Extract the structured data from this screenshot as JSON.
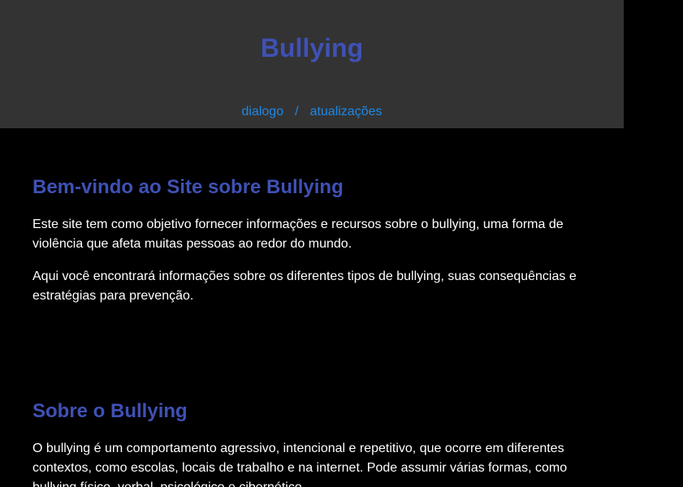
{
  "header": {
    "title": "Bullying",
    "nav": {
      "dialogo": "dialogo",
      "separator": "/",
      "atualizacoes": "atualizações"
    }
  },
  "welcome": {
    "heading": "Bem-vindo ao Site sobre Bullying",
    "paragraphs": [
      "Este site tem como objetivo fornecer informações e recursos sobre o bullying, uma forma de violência que afeta muitas pessoas ao redor do mundo.",
      "Aqui você encontrará informações sobre os diferentes tipos de bullying, suas consequências e estratégias para prevenção."
    ]
  },
  "about": {
    "heading": "Sobre o Bullying",
    "paragraphs": [
      "O bullying é um comportamento agressivo, intencional e repetitivo, que ocorre em diferentes contextos, como escolas, locais de trabalho e na internet. Pode assumir várias formas, como bullying físico, verbal, psicológico e cibernético."
    ]
  },
  "colors": {
    "header_bg": "#333333",
    "page_bg": "#000000",
    "heading": "#3f51b5",
    "link": "#1e88e5",
    "text": "#ffffff"
  }
}
